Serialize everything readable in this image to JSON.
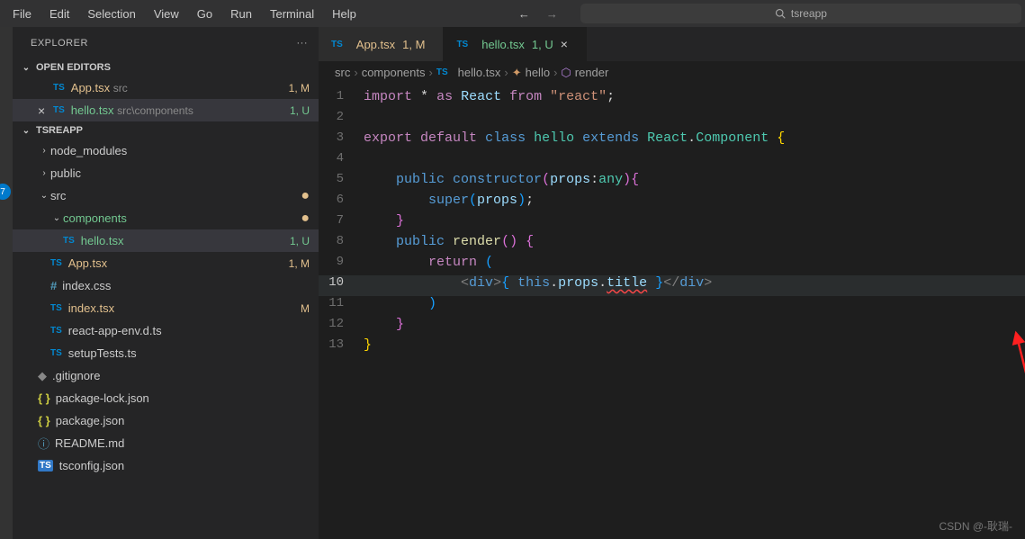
{
  "menubar": {
    "items": [
      "File",
      "Edit",
      "Selection",
      "View",
      "Go",
      "Run",
      "Terminal",
      "Help"
    ],
    "search_placeholder": "tsreapp"
  },
  "activity": {
    "badge": "7"
  },
  "explorer": {
    "title": "EXPLORER",
    "openEditors": {
      "title": "OPEN EDITORS"
    },
    "entries": [
      {
        "name": "App.tsx",
        "path": "src",
        "status": "1, M",
        "git": true
      },
      {
        "name": "hello.tsx",
        "path": "src\\components",
        "status": "1, U",
        "untracked": true,
        "active": true,
        "close": true
      }
    ],
    "project": {
      "title": "TSREAPP"
    },
    "tree": [
      {
        "name": "node_modules",
        "kind": "folder",
        "chev": ">",
        "indent": 1
      },
      {
        "name": "public",
        "kind": "folder",
        "chev": ">",
        "indent": 1
      },
      {
        "name": "src",
        "kind": "folder",
        "chev": "v",
        "indent": 1,
        "dot": true
      },
      {
        "name": "components",
        "kind": "folder",
        "chev": "v",
        "indent": 2,
        "untracked": true,
        "dot": true
      },
      {
        "name": "hello.tsx",
        "kind": "ts",
        "indent": 3,
        "untracked": true,
        "status": "1, U",
        "active": true
      },
      {
        "name": "App.tsx",
        "kind": "ts",
        "indent": 2,
        "git": true,
        "status": "1, M"
      },
      {
        "name": "index.css",
        "kind": "css",
        "indent": 2
      },
      {
        "name": "index.tsx",
        "kind": "ts",
        "indent": 2,
        "status": "M",
        "git": true
      },
      {
        "name": "react-app-env.d.ts",
        "kind": "ts",
        "indent": 2
      },
      {
        "name": "setupTests.ts",
        "kind": "ts",
        "indent": 2
      },
      {
        "name": ".gitignore",
        "kind": "git",
        "indent": 1
      },
      {
        "name": "package-lock.json",
        "kind": "json",
        "indent": 1
      },
      {
        "name": "package.json",
        "kind": "json",
        "indent": 1
      },
      {
        "name": "README.md",
        "kind": "info",
        "indent": 1
      },
      {
        "name": "tsconfig.json",
        "kind": "tsicon",
        "indent": 1
      }
    ]
  },
  "tabs": [
    {
      "icon": "TS",
      "name": "App.tsx",
      "status": "1, M",
      "git": true
    },
    {
      "icon": "TS",
      "name": "hello.tsx",
      "status": "1, U",
      "untracked": true,
      "active": true,
      "close": true
    }
  ],
  "breadcrumbs": {
    "src": "src",
    "components": "components",
    "file": "hello.tsx",
    "sym1": "hello",
    "sym2": "render"
  },
  "code": {
    "lines": [
      {
        "n": 1,
        "html": "<span class='kw1'>import</span> <span class='plain'>*</span> <span class='kw1'>as</span> <span class='var'>React</span> <span class='kw1'>from</span> <span class='str'>\"react\"</span><span class='plain'>;</span>"
      },
      {
        "n": 2,
        "html": ""
      },
      {
        "n": 3,
        "html": "<span class='kw1'>export</span> <span class='kw1'>default</span> <span class='kw2'>class</span> <span class='cls'>hello</span> <span class='kw2'>extends</span> <span class='cls'>React</span><span class='plain'>.</span><span class='cls'>Component</span> <span class='brace-y'>{</span>"
      },
      {
        "n": 4,
        "html": ""
      },
      {
        "n": 5,
        "html": "    <span class='kw2'>public</span> <span class='kw2'>constructor</span><span class='brace-p'>(</span><span class='var'>props</span><span class='plain'>:</span><span class='cls'>any</span><span class='brace-p'>)</span><span class='brace-p'>{</span>"
      },
      {
        "n": 6,
        "html": "        <span class='kw2'>super</span><span class='brace-b'>(</span><span class='var'>props</span><span class='brace-b'>)</span><span class='plain'>;</span>"
      },
      {
        "n": 7,
        "html": "    <span class='brace-p'>}</span>"
      },
      {
        "n": 8,
        "html": "    <span class='kw2'>public</span> <span class='fn'>render</span><span class='brace-p'>()</span> <span class='brace-p'>{</span>"
      },
      {
        "n": 9,
        "html": "        <span class='kw1'>return</span> <span class='brace-b'>(</span>"
      },
      {
        "n": 10,
        "html": "            <span class='tag'>&lt;</span><span class='tagname'>div</span><span class='tag'>&gt;</span><span class='brace-b'>{</span> <span class='kw2'>this</span><span class='plain'>.</span><span class='var'>props</span><span class='plain'>.</span><span class='var underline-err'>title</span> <span class='brace-b'>}</span><span class='tag'>&lt;/</span><span class='tagname'>div</span><span class='tag'>&gt;</span>",
        "hl": true
      },
      {
        "n": 11,
        "html": "        <span class='brace-b'>)</span>"
      },
      {
        "n": 12,
        "html": "    <span class='brace-p'>}</span>"
      },
      {
        "n": 13,
        "html": "<span class='brace-y'>}</span>"
      }
    ]
  },
  "watermark": "CSDN @-耿瑞-"
}
